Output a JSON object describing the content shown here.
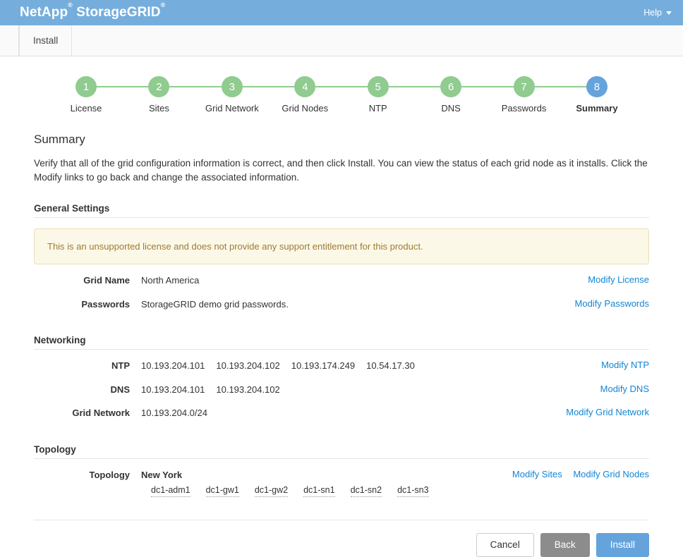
{
  "header": {
    "brand_name": "NetApp",
    "brand_product": "StorageGRID",
    "registered_mark": "®",
    "help_label": "Help",
    "brand_bar_color": "#75aedd"
  },
  "tabs": [
    {
      "label": "Install",
      "active": true
    }
  ],
  "wizard": {
    "steps": [
      {
        "number": "1",
        "label": "License",
        "state": "complete"
      },
      {
        "number": "2",
        "label": "Sites",
        "state": "complete"
      },
      {
        "number": "3",
        "label": "Grid Network",
        "state": "complete"
      },
      {
        "number": "4",
        "label": "Grid Nodes",
        "state": "complete"
      },
      {
        "number": "5",
        "label": "NTP",
        "state": "complete"
      },
      {
        "number": "6",
        "label": "DNS",
        "state": "complete"
      },
      {
        "number": "7",
        "label": "Passwords",
        "state": "complete"
      },
      {
        "number": "8",
        "label": "Summary",
        "state": "active"
      }
    ],
    "complete_color": "#90cb90",
    "active_color": "#64a3dc"
  },
  "page": {
    "title": "Summary",
    "description": "Verify that all of the grid configuration information is correct, and then click Install. You can view the status of each grid node as it installs. Click the Modify links to go back and change the associated information."
  },
  "general_settings": {
    "heading": "General Settings",
    "warning": "This is an unsupported license and does not provide any support entitlement for this product.",
    "warning_text_color": "#9a7b34",
    "warning_bg_color": "#fcf8e8",
    "rows": [
      {
        "label": "Grid Name",
        "value": "North America",
        "links": [
          "Modify License"
        ]
      },
      {
        "label": "Passwords",
        "value": "StorageGRID demo grid passwords.",
        "links": [
          "Modify Passwords"
        ]
      }
    ]
  },
  "networking": {
    "heading": "Networking",
    "rows": [
      {
        "label": "NTP",
        "values": [
          "10.193.204.101",
          "10.193.204.102",
          "10.193.174.249",
          "10.54.17.30"
        ],
        "links": [
          "Modify NTP"
        ]
      },
      {
        "label": "DNS",
        "values": [
          "10.193.204.101",
          "10.193.204.102"
        ],
        "links": [
          "Modify DNS"
        ]
      },
      {
        "label": "Grid Network",
        "values": [
          "10.193.204.0/24"
        ],
        "links": [
          "Modify Grid Network"
        ]
      }
    ]
  },
  "topology": {
    "heading": "Topology",
    "row": {
      "label": "Topology",
      "site": "New York",
      "nodes": [
        "dc1-adm1",
        "dc1-gw1",
        "dc1-gw2",
        "dc1-sn1",
        "dc1-sn2",
        "dc1-sn3"
      ],
      "links": [
        "Modify Sites",
        "Modify Grid Nodes"
      ]
    }
  },
  "footer": {
    "cancel_label": "Cancel",
    "back_label": "Back",
    "install_label": "Install",
    "primary_color": "#64a3dc",
    "secondary_color": "#8c8c8c"
  },
  "link_color": "#1185d5"
}
